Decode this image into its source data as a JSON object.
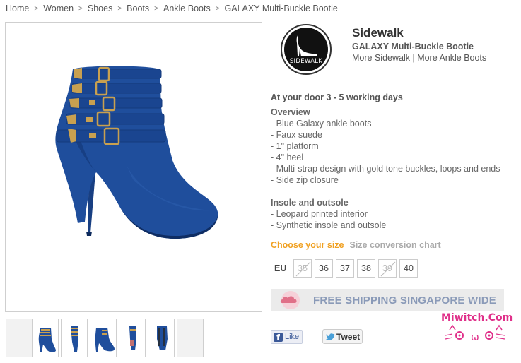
{
  "breadcrumb": {
    "items": [
      "Home",
      "Women",
      "Shoes",
      "Boots",
      "Ankle Boots",
      "GALAXY Multi-Buckle Bootie"
    ],
    "separator": ">"
  },
  "product_images": {
    "main_icon": "blue-ankle-bootie-image",
    "thumbnails_icon": "bootie-thumbnail"
  },
  "brand": {
    "logo_text": "SIDEWALK",
    "name": "Sidewalk",
    "product_title": "GALAXY Multi-Buckle Bootie",
    "more_brand_link": "More Sidewalk",
    "link_separator": " | ",
    "more_category_link": "More Ankle Boots"
  },
  "delivery": "At your door 3 - 5 working days",
  "overview": {
    "heading": "Overview",
    "items": [
      "- Blue Galaxy ankle boots",
      "- Faux suede",
      "- 1\" platform",
      "- 4\" heel",
      "- Multi-strap design with gold tone buckles, loops and ends",
      "- Side zip closure"
    ]
  },
  "insole": {
    "heading": "Insole and outsole",
    "items": [
      "- Leopard printed interior",
      "- Synthetic insole and outsole"
    ]
  },
  "size": {
    "choose_label": "Choose your size",
    "chart_label": "Size conversion chart",
    "region_label": "EU",
    "options": [
      {
        "label": "35",
        "available": false
      },
      {
        "label": "36",
        "available": true
      },
      {
        "label": "37",
        "available": true
      },
      {
        "label": "38",
        "available": true
      },
      {
        "label": "39",
        "available": false
      },
      {
        "label": "40",
        "available": true
      }
    ]
  },
  "shipping_banner": {
    "text": "FREE SHIPPING SINGAPORE WIDE",
    "icon": "cloud-icon"
  },
  "social": {
    "like_label": "Like",
    "tweet_label": "Tweet"
  },
  "watermark": {
    "text": "Miwitch.Com"
  },
  "colors": {
    "accent_orange": "#f0a020",
    "boot_blue": "#1f4e9c",
    "banner_text": "#8a9ab8",
    "facebook_blue": "#3b5998",
    "watermark_pink": "#e0308a"
  }
}
